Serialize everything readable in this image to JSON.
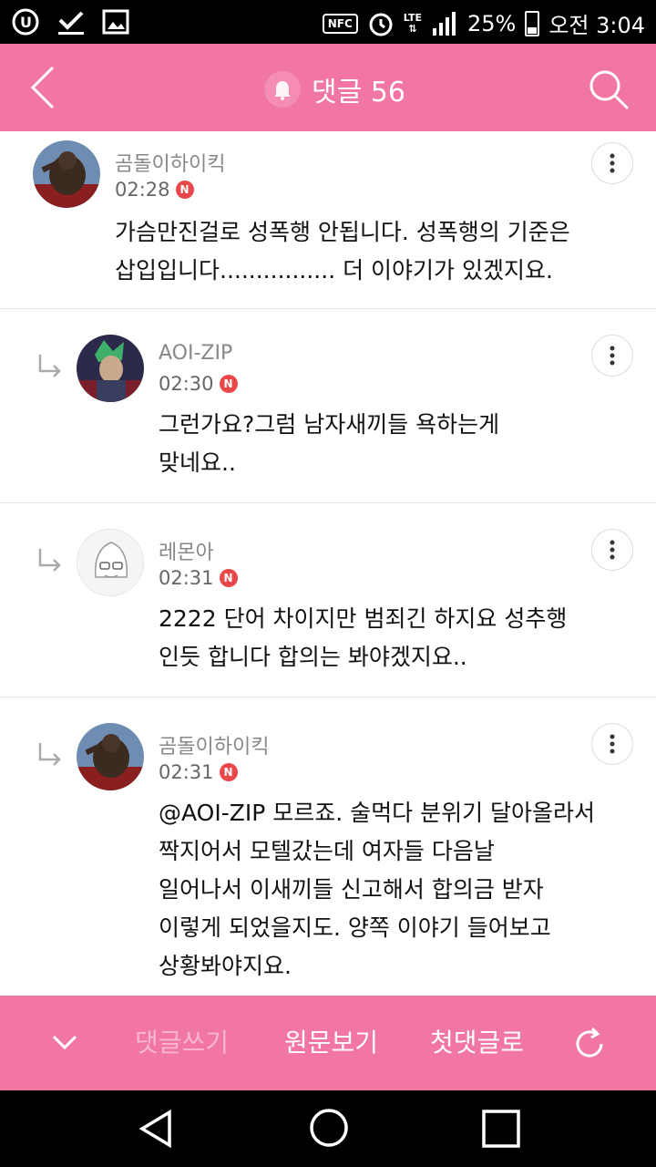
{
  "statusbar": {
    "battery": "25%",
    "time": "오전 3:04",
    "nfc": "NFC",
    "lte": "LTE"
  },
  "header": {
    "title": "댓글 56"
  },
  "comments": [
    {
      "author": "곰돌이하이킥",
      "time": "02:28",
      "badge": "N",
      "line1": "가슴만진걸로 성폭행 안됩니다. 성폭행의 기준은",
      "line2": "삽입입니다................ 더 이야기가 있겠지요.",
      "reply": false
    },
    {
      "author": "AOI-ZIP",
      "time": "02:30",
      "badge": "N",
      "line1": "그런가요?그럼 남자새끼들 욕하는게",
      "line2": "맞네요..",
      "reply": true
    },
    {
      "author": "레몬아",
      "time": "02:31",
      "badge": "N",
      "line1": "2222 단어 차이지만 범죄긴 하지요 성추행",
      "line2": "인듯 합니다 합의는 봐야겠지요..",
      "reply": true
    },
    {
      "author": "곰돌이하이킥",
      "time": "02:31",
      "badge": "N",
      "line1": "@AOI-ZIP 모르죠. 술먹다 분위기 달아올라서",
      "line2": "짝지어서 모텔갔는데 여자들 다음날",
      "line3": "일어나서 이새끼들 신고해서 합의금 받자",
      "line4": "이렇게 되었을지도. 양쪽 이야기 들어보고",
      "line5": "상황봐야지요.",
      "reply": true
    }
  ],
  "bottombar": {
    "write": "댓글쓰기",
    "original": "원문보기",
    "first": "첫댓글로"
  },
  "colors": {
    "accent": "#f276a3",
    "new_badge": "#e8484a"
  },
  "icons": [
    "back-arrow-icon",
    "bell-icon",
    "search-icon",
    "more-vert-icon",
    "reply-arrow-icon",
    "chevron-down-icon",
    "refresh-icon"
  ]
}
